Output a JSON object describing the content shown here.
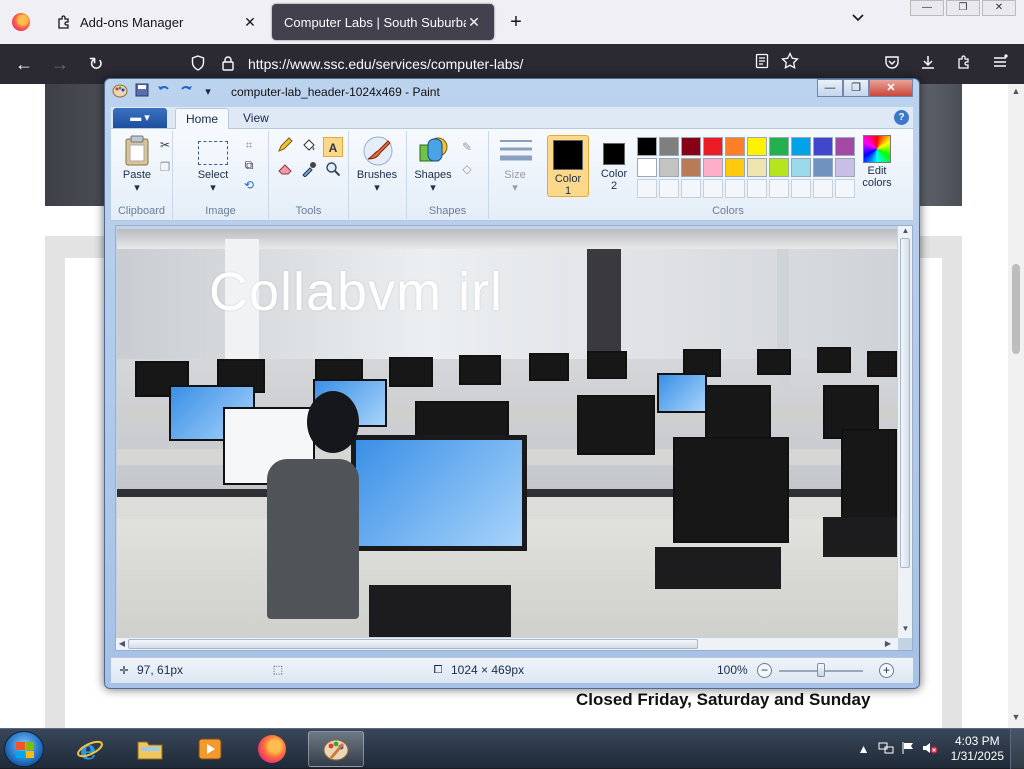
{
  "browser": {
    "tabs": [
      {
        "title": "Add-ons Manager",
        "close": "✕"
      },
      {
        "title": "Computer Labs | South Suburban C",
        "close": "✕"
      }
    ],
    "new_tab": "+",
    "tab_list": "⌄",
    "window_controls": [
      "—",
      "❐",
      "✕"
    ],
    "url": "https://www.ssc.edu/services/computer-labs/",
    "nav": {
      "back": "←",
      "forward": "→",
      "reload": "↻"
    }
  },
  "page": {
    "notice": "Closed Friday, Saturday and Sunday"
  },
  "paint": {
    "title": "computer-lab_header-1024x469 - Paint",
    "window_controls": {
      "minimize": "—",
      "maximize": "❐",
      "close": "✕"
    },
    "tabs": {
      "file": "▬ ▾",
      "home": "Home",
      "view": "View"
    },
    "help": "?",
    "groups": {
      "clipboard": {
        "label": "Clipboard",
        "paste": "Paste"
      },
      "image": {
        "label": "Image",
        "select": "Select"
      },
      "tools": {
        "label": "Tools"
      },
      "brushes": {
        "label": "Brushes"
      },
      "shapes": {
        "label": "Shapes",
        "button": "Shapes"
      },
      "size": {
        "label": "Size"
      },
      "colors": {
        "label": "Colors",
        "color1": "Color\n1",
        "color1_line1": "Color",
        "color1_line2": "1",
        "color2_line1": "Color",
        "color2_line2": "2",
        "edit_line1": "Edit",
        "edit_line2": "colors"
      }
    },
    "palette_row1": [
      "#000000",
      "#7f7f7f",
      "#880015",
      "#ed1c24",
      "#ff7f27",
      "#fff200",
      "#22b14c",
      "#00a2e8",
      "#3f48cc",
      "#a349a4"
    ],
    "palette_row2": [
      "#ffffff",
      "#c3c3c3",
      "#b97a57",
      "#ffaec9",
      "#ffc90e",
      "#efe4b0",
      "#b5e61d",
      "#99d9ea",
      "#7092be",
      "#c8bfe7"
    ],
    "canvas_text": "Collabvm irl",
    "status": {
      "cursor_pos": "97, 61px",
      "image_size": "1024 × 469px",
      "zoom": "100%"
    }
  },
  "taskbar": {
    "time": "4:03 PM",
    "date": "1/31/2025"
  }
}
